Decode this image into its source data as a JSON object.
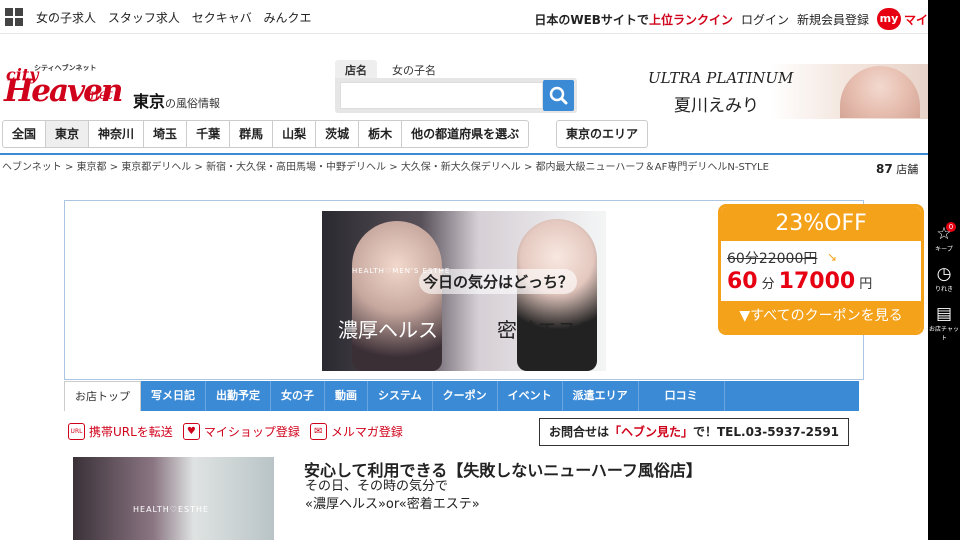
{
  "topbar": {
    "links": [
      "女の子求人",
      "スタッフ求人",
      "セクキャバ",
      "みんクエ"
    ],
    "site_prefix": "日本のWEBサイトで",
    "site_rank": "上位ランクイン",
    "login": "ログイン",
    "register": "新規会員登録",
    "my_label": "my",
    "my_suffix": "マイ"
  },
  "logo": {
    "tagline": "シティヘブンネット",
    "city": "city",
    "heaven": "Heaven",
    "net": "net"
  },
  "region": {
    "name": "東京",
    "suffix": "の風俗情報"
  },
  "search": {
    "tab_active": "店名",
    "tab_other": "女の子名",
    "placeholder": ""
  },
  "banner": {
    "brand": "ULTRA PLATINUM",
    "name": "夏川えみり"
  },
  "prefectures": [
    "全国",
    "東京",
    "神奈川",
    "埼玉",
    "千葉",
    "群馬",
    "山梨",
    "茨城",
    "栃木",
    "他の都道府県を選ぶ"
  ],
  "area_button": "東京のエリア",
  "breadcrumb": [
    "ヘブンネット",
    "東京都",
    "東京都デリヘル",
    "新宿・大久保・高田馬場・中野デリヘル",
    "大久保・新大久保デリヘル",
    "都内最大級ニューハーフ＆AF専門デリヘルN-STYLE"
  ],
  "store_count": {
    "number": "87",
    "unit": "店舗"
  },
  "shop_image": {
    "sub": "HEALTH♡MEN'S ESTHE",
    "question": "今日の気分はどっち？",
    "left": "濃厚ヘルス",
    "right": "密着エステ"
  },
  "coupon": {
    "headline": "23%OFF",
    "old_price": "60分22000円",
    "new_minutes": "60",
    "minute_unit": "分",
    "new_price": "17000",
    "yen": "円",
    "see_all": "▼すべてのクーポンを見る"
  },
  "right_sidebar": {
    "keep_label": "キープ",
    "keep_count": "0",
    "history_label": "りれき",
    "chat_label": "お店チャット"
  },
  "shop_tabs": [
    "お店トップ",
    "写メ日記",
    "出勤予定",
    "女の子",
    "動画",
    "システム",
    "クーポン",
    "イベント",
    "派遣エリア",
    "口コミ"
  ],
  "shop_links": [
    {
      "icon": "URL",
      "label": "携帯URLを転送"
    },
    {
      "icon": "♥",
      "label": "マイショップ登録"
    },
    {
      "icon": "✉",
      "label": "メルマガ登録"
    }
  ],
  "inquiry": {
    "prefix": "お問合せは",
    "highlight": "「ヘブン見た」",
    "suffix": "で！TEL.03-5937-2591"
  },
  "thumb_text": "HEALTH♡ESTHE",
  "catch": "安心して利用できる【失敗しないニューハーフ風俗店】",
  "desc_lines": [
    "その日、その時の気分で",
    "«濃厚ヘルス»or«密着エステ»"
  ],
  "colors": {
    "accent": "#3b8ad6",
    "brand_red": "#d0021b",
    "coupon_orange": "#f5a21b"
  }
}
